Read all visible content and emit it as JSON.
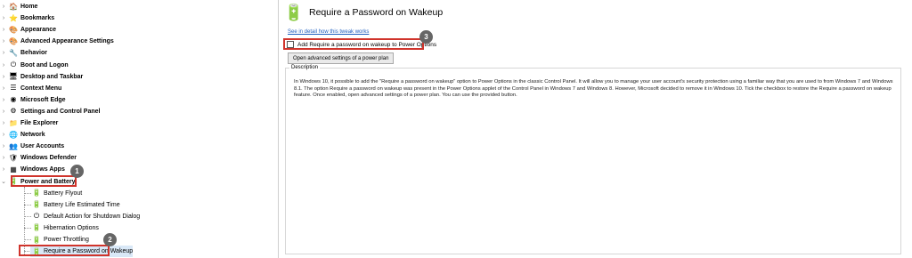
{
  "tree": {
    "items": [
      {
        "label": "Home",
        "icon": "home-icon",
        "glyph": "🏠"
      },
      {
        "label": "Bookmarks",
        "icon": "star-icon",
        "glyph": "⭐"
      },
      {
        "label": "Appearance",
        "icon": "palette-icon",
        "glyph": "🎨"
      },
      {
        "label": "Advanced Appearance Settings",
        "icon": "palette-advanced-icon",
        "glyph": "🎨"
      },
      {
        "label": "Behavior",
        "icon": "behavior-icon",
        "glyph": "🔧"
      },
      {
        "label": "Boot and Logon",
        "icon": "boot-icon",
        "glyph": "⏻"
      },
      {
        "label": "Desktop and Taskbar",
        "icon": "desktop-icon",
        "glyph": "🖥"
      },
      {
        "label": "Context Menu",
        "icon": "context-menu-icon",
        "glyph": "☰"
      },
      {
        "label": "Microsoft Edge",
        "icon": "edge-icon",
        "glyph": "◉"
      },
      {
        "label": "Settings and Control Panel",
        "icon": "gear-icon",
        "glyph": "⚙"
      },
      {
        "label": "File Explorer",
        "icon": "folder-icon",
        "glyph": "📁"
      },
      {
        "label": "Network",
        "icon": "network-icon",
        "glyph": "🌐"
      },
      {
        "label": "User Accounts",
        "icon": "users-icon",
        "glyph": "👥"
      },
      {
        "label": "Windows Defender",
        "icon": "shield-icon",
        "glyph": "🛡"
      },
      {
        "label": "Windows Apps",
        "icon": "apps-icon",
        "glyph": "▦"
      },
      {
        "label": "Power and Battery",
        "icon": "battery-icon",
        "glyph": "🔋"
      }
    ],
    "children": [
      {
        "label": "Battery Flyout",
        "icon": "battery-icon",
        "glyph": "🔋"
      },
      {
        "label": "Battery Life Estimated Time",
        "icon": "battery-icon",
        "glyph": "🔋"
      },
      {
        "label": "Default Action for Shutdown Dialog",
        "icon": "shutdown-icon",
        "glyph": "⏻"
      },
      {
        "label": "Hibernation Options",
        "icon": "battery-icon",
        "glyph": "🔋"
      },
      {
        "label": "Power Throttling",
        "icon": "battery-icon",
        "glyph": "🔋"
      },
      {
        "label": "Require a Password on Wakeup",
        "icon": "battery-icon",
        "glyph": "🔋"
      }
    ]
  },
  "badges": {
    "one": "1",
    "two": "2",
    "three": "3"
  },
  "main": {
    "header_icon_glyph": "🔋",
    "title": "Require a Password on Wakeup",
    "link": "See in detail how this tweak works",
    "checkbox_label": "Add Require a password on wakeup to Power Options",
    "checkbox_checked": false,
    "button": "Open advanced settings of a power plan",
    "description_label": "Description",
    "description": "In Windows 10, it possible to add the \"Require a password on wakeup\" option to Power Options in the classic Control Panel. It will allow you to manage your user account's security protection using a familiar way that you are used to from Windows 7 and Windows 8.1. The option Require a password on wakeup was present in the Power Options applet of the Control Panel in Windows 7 and Windows 8. However, Microsoft decided to remove it in Windows 10. Tick the checkbox to restore the Require a password on wakeup feature. Once enabled, open advanced settings of a power plan. You can use the provided button."
  },
  "colors": {
    "highlight": "#d0342c",
    "badge": "#666666",
    "link": "#1f5fbf",
    "selection": "#d9e8f7"
  }
}
